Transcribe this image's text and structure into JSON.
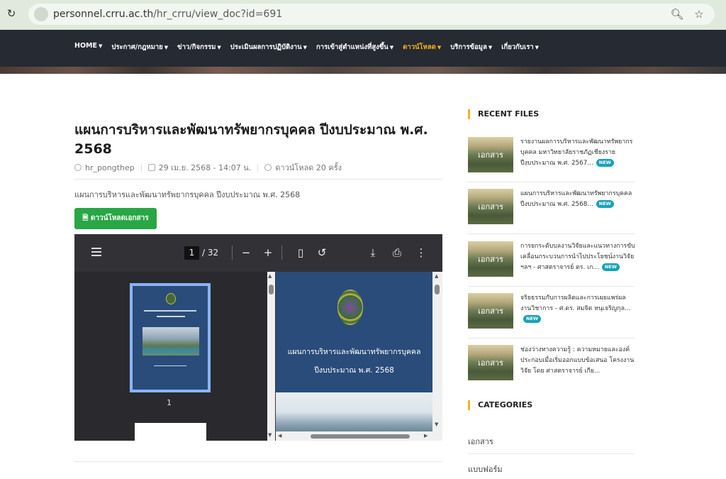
{
  "browser": {
    "url_host": "personnel.crru.ac.th",
    "url_path": "/hr_crru/view_doc?id=691"
  },
  "nav": {
    "items": [
      {
        "label": "HOME",
        "active": false
      },
      {
        "label": "ประกาศ/กฎหมาย",
        "active": false
      },
      {
        "label": "ข่าว/กิจกรรม",
        "active": false
      },
      {
        "label": "ประเมินผลการปฏิบัติงาน",
        "active": false
      },
      {
        "label": "การเข้าสู่ตำแหน่งที่สูงขึ้น",
        "active": false
      },
      {
        "label": "ดาวน์โหลด",
        "active": true
      },
      {
        "label": "บริการข้อมูล",
        "active": false
      },
      {
        "label": "เกี่ยวกับเรา",
        "active": false
      }
    ],
    "active_color": "#f5b21a"
  },
  "post": {
    "title": "แผนการบริหารและพัฒนาทรัพยากรบุคคล ปีงบประมาณ พ.ศ. 2568",
    "author": "hr_pongthep",
    "date": "29 เม.ย. 2568 - 14:07 น.",
    "downloads": "ดาวน์โหลด 20 ครั้ง",
    "description": "แผนการบริหารและพัฒนาทรัพยากรบุคคล ปีงบประมาณ พ.ศ. 2568",
    "download_button": "ดาวน์โหลดเอกสาร",
    "button_color": "#28a745"
  },
  "pdf": {
    "current_page": "1",
    "total_pages": "/ 32",
    "thumb_label": "1",
    "page_title_line1": "แผนการบริหารและพัฒนาทรัพยากรบุคคล",
    "page_title_line2": "ปีงบประมาณ พ.ศ. 2568",
    "toolbar_icons": [
      "menu-icon",
      "zoom-out-icon",
      "zoom-in-icon",
      "fit-page-icon",
      "rotate-icon",
      "download-icon",
      "print-icon",
      "more-icon"
    ]
  },
  "sidebar": {
    "recent_heading": "RECENT FILES",
    "thumb_label": "เอกสาร",
    "new_badge": "NEW",
    "files": [
      {
        "title": "รายงานผลการบริหารและพัฒนาทรัพยากรบุคคล มหาวิทยาลัยราชภัฏเชียงราย ปีงบประมาณ พ.ศ. 2567...",
        "new": true
      },
      {
        "title": "แผนการบริหารและพัฒนาทรัพยากรบุคคล ปีงบประมาณ พ.ศ. 2568...",
        "new": true
      },
      {
        "title": "การยกระดับบลงานวิจัยและแนวทางการขับเคลื่อนกระบวนการนำไปประโยชน์งานวิจัย ฯลฯ - ศาสตราจารย์ ดร. เก...",
        "new": true
      },
      {
        "title": "จริยธรรมกับการผลิตและการเผยแพร่ผลงานวิชาการ - ศ.ดร. สมจิต หนุเจริญกุล...",
        "new": true
      },
      {
        "title": "ช่องว่างทางความรู้ : ความหมายและองค์ประกอบเมื่อเริ่มออกแบบข้อเสนอ โครงงานวิจัย โดย ศาสตราจารย์ เกีย...",
        "new": false
      }
    ],
    "categories_heading": "CATEGORIES",
    "categories": [
      "เอกสาร",
      "แบบฟอร์ม"
    ]
  }
}
